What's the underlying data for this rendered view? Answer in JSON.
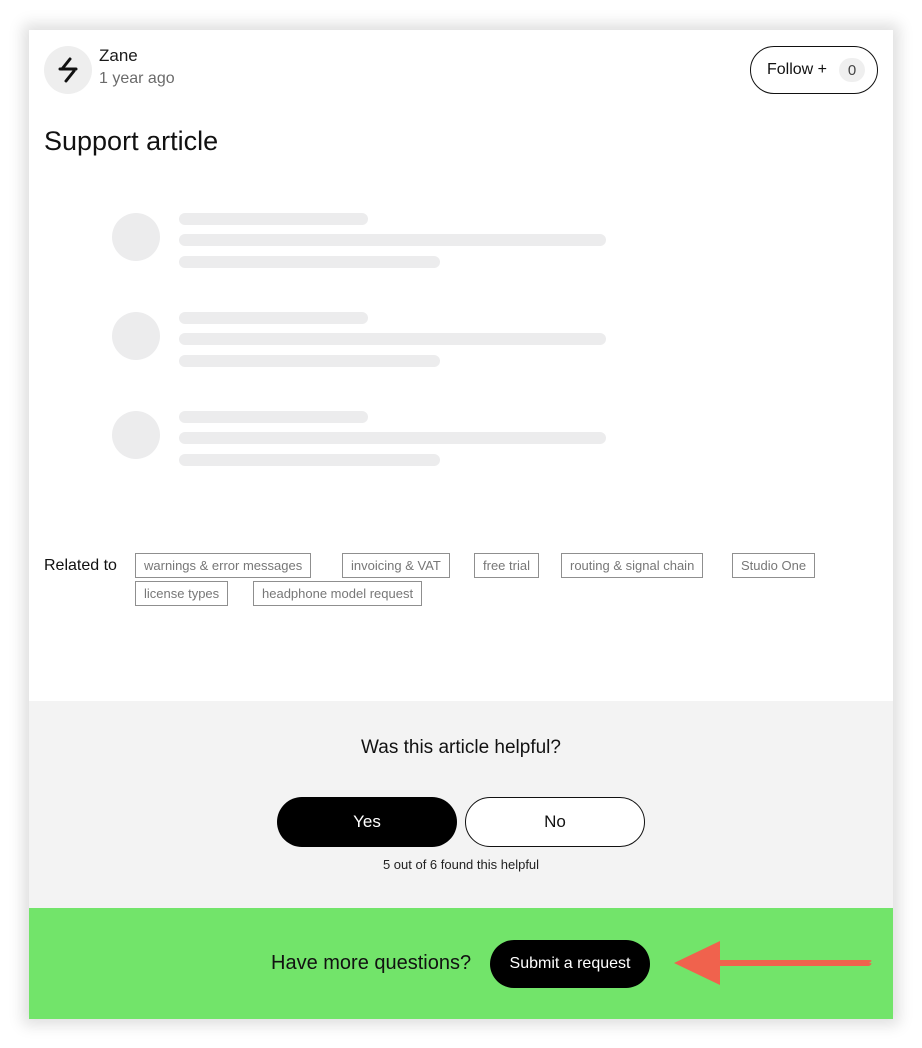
{
  "author": {
    "name": "Zane",
    "time": "1 year ago",
    "avatar_icon": "strike-logo-icon"
  },
  "follow": {
    "label": "Follow +",
    "count": "0"
  },
  "article": {
    "title": "Support article"
  },
  "related": {
    "label": "Related to",
    "tags": [
      "warnings & error messages",
      "invoicing & VAT",
      "free trial",
      "routing & signal chain",
      "Studio One",
      "license types",
      "headphone model request"
    ]
  },
  "feedback": {
    "question": "Was this article helpful?",
    "yes_label": "Yes",
    "no_label": "No",
    "summary": "5 out of 6 found this helpful"
  },
  "cta": {
    "text": "Have more questions?",
    "button_label": "Submit a request",
    "background": "#72e46a",
    "arrow_color": "#f0624d"
  }
}
